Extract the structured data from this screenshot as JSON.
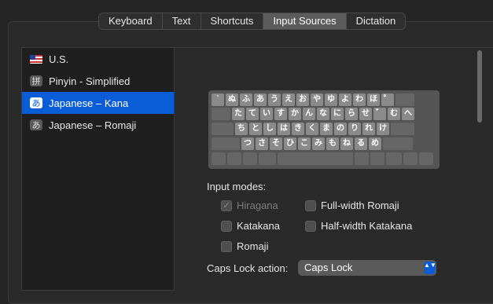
{
  "tabs": [
    "Keyboard",
    "Text",
    "Shortcuts",
    "Input Sources",
    "Dictation"
  ],
  "active_tab": "Input Sources",
  "sources": [
    {
      "label": "U.S.",
      "icon": "us-flag-icon"
    },
    {
      "label": "Pinyin - Simplified",
      "icon": "拼"
    },
    {
      "label": "Japanese – Kana",
      "icon": "あ"
    },
    {
      "label": "Japanese – Romaji",
      "icon": "あ"
    }
  ],
  "keyboard": {
    "row1": [
      "`",
      "ぬ",
      "ふ",
      "あ",
      "う",
      "え",
      "お",
      "や",
      "ゆ",
      "よ",
      "わ",
      "ほ",
      "゜"
    ],
    "row2": [
      "た",
      "て",
      "い",
      "す",
      "か",
      "ん",
      "な",
      "に",
      "ら",
      "せ",
      "゛",
      "む",
      "へ"
    ],
    "row3": [
      "ち",
      "と",
      "し",
      "は",
      "き",
      "く",
      "ま",
      "の",
      "り",
      "れ",
      "け"
    ],
    "row4": [
      "つ",
      "さ",
      "そ",
      "ひ",
      "こ",
      "み",
      "も",
      "ね",
      "る",
      "め"
    ]
  },
  "input_modes_label": "Input modes:",
  "modes": {
    "hiragana": "Hiragana",
    "full_width_romaji": "Full-width Romaji",
    "katakana": "Katakana",
    "half_width_katakana": "Half-width Katakana",
    "romaji": "Romaji"
  },
  "checkmark": "✓",
  "caps_lock_label": "Caps Lock action:",
  "caps_lock_value": "Caps Lock",
  "select_arrows": "▲▼",
  "colors": {
    "accent": "#0b5dd7",
    "background": "#252525"
  }
}
